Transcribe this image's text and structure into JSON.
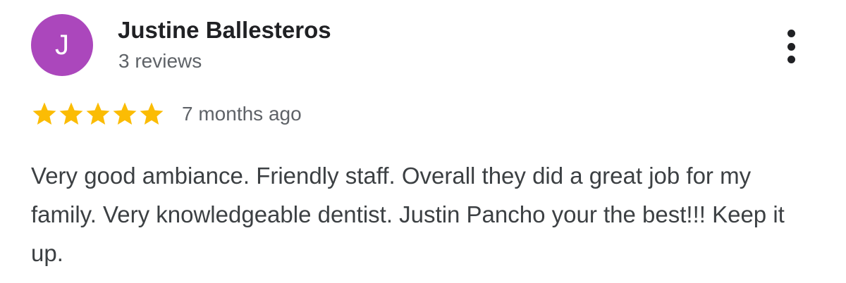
{
  "review": {
    "avatar_initial": "J",
    "avatar_color": "#ab47bc",
    "reviewer_name": "Justine Ballesteros",
    "review_count": "3 reviews",
    "more_icon": "more-vert-icon",
    "rating": 5,
    "rating_max": 5,
    "star_color": "#fbbc04",
    "time_ago": "7 months ago",
    "text": "Very good ambiance. Friendly staff. Overall they did a great job for my family. Very knowledgeable dentist. Justin Pancho your the best!!! Keep it up."
  }
}
